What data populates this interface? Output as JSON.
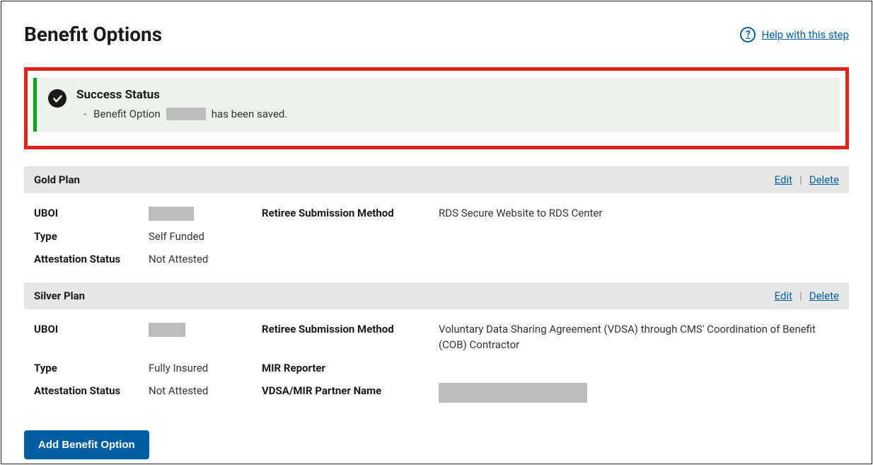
{
  "header": {
    "title": "Benefit Options",
    "help_link": "Help with this step"
  },
  "alert": {
    "title": "Success Status",
    "msg_prefix": "Benefit Option",
    "msg_suffix": "has been saved."
  },
  "plans": [
    {
      "name": "Gold Plan",
      "edit": "Edit",
      "delete": "Delete",
      "uboi_label": "UBOI",
      "type_label": "Type",
      "type_value": "Self Funded",
      "attest_label": "Attestation Status",
      "attest_value": "Not Attested",
      "retiree_label": "Retiree Submission Method",
      "retiree_value": "RDS Secure Website to RDS Center"
    },
    {
      "name": "Silver Plan",
      "edit": "Edit",
      "delete": "Delete",
      "uboi_label": "UBOI",
      "type_label": "Type",
      "type_value": "Fully Insured",
      "attest_label": "Attestation Status",
      "attest_value": "Not Attested",
      "retiree_label": "Retiree Submission Method",
      "retiree_value": "Voluntary Data Sharing Agreement (VDSA) through CMS' Coordination of Benefit (COB) Contractor",
      "mir_label": "MIR Reporter",
      "vdsa_label": "VDSA/MIR Partner Name"
    }
  ],
  "buttons": {
    "add": "Add Benefit Option"
  }
}
